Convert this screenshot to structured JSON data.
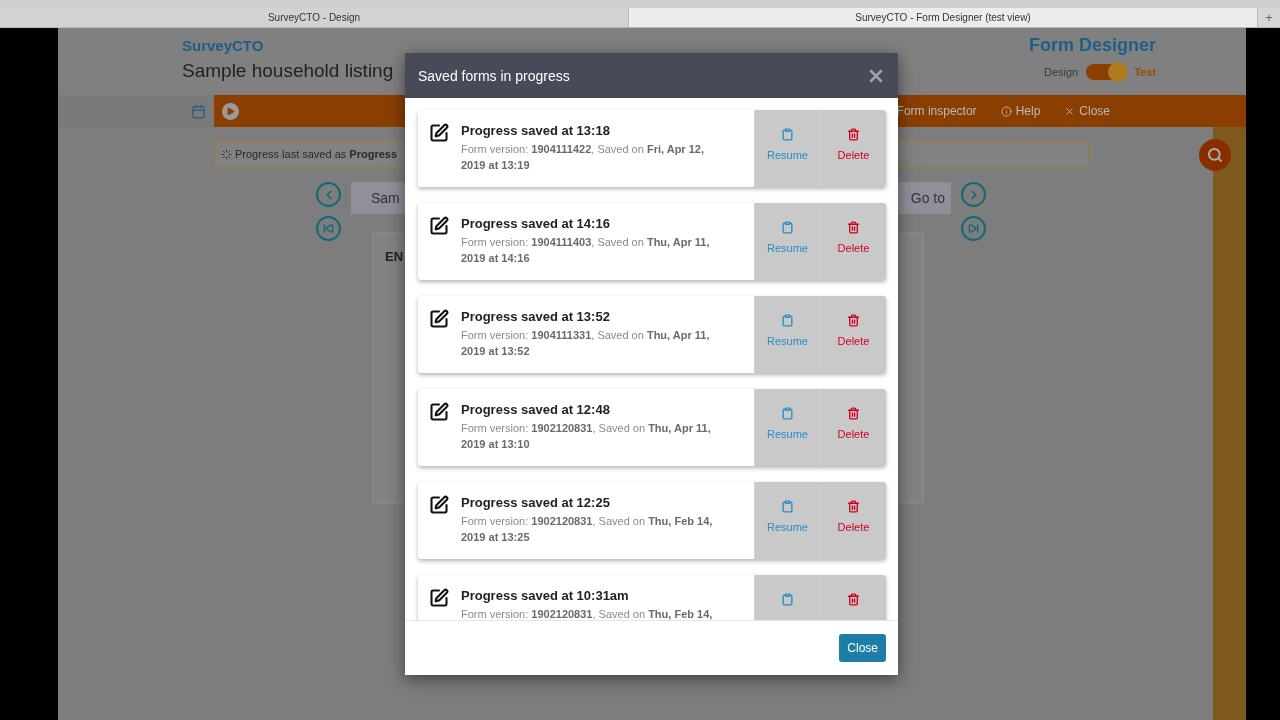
{
  "browser_tabs": [
    {
      "label": "SurveyCTO - Design",
      "selected": false
    },
    {
      "label": "SurveyCTO - Form Designer (test view)",
      "selected": true
    }
  ],
  "new_tab": "+",
  "header": {
    "logo": "SurveyCTO",
    "form_title": "Sample household listing",
    "app_title": "Form Designer",
    "mode_left": "Design",
    "mode_right": "Test",
    "test_mode": true
  },
  "toolbar": {
    "items": [
      {
        "kind": "inspector",
        "label": "Form inspector"
      },
      {
        "kind": "help",
        "label": "Help"
      },
      {
        "kind": "close",
        "label": "Close"
      }
    ]
  },
  "banner": "Progress last saved as **Progress**",
  "nav": {
    "group_left": "Sam",
    "group_right": "Go to",
    "field_label": "EN"
  },
  "modal": {
    "title": "Saved forms in progress",
    "entries": [
      {
        "title": "Progress saved at 13:18",
        "detail": "Form version: **1904111422**, Saved on **Fri, Apr 12, 2019 at 13:19**",
        "resume": "Resume",
        "delete": "Delete"
      },
      {
        "title": "Progress saved at 14:16",
        "detail": "Form version: **1904111403**, Saved on **Thu, Apr 11, 2019 at 14:16**",
        "resume": "Resume",
        "delete": "Delete"
      },
      {
        "title": "Progress saved at 13:52",
        "detail": "Form version: **1904111331**, Saved on **Thu, Apr 11, 2019 at 13:52**",
        "resume": "Resume",
        "delete": "Delete"
      },
      {
        "title": "Progress saved at 12:48",
        "detail": "Form version: **1902120831**, Saved on **Thu, Apr 11, 2019 at 13:10**",
        "resume": "Resume",
        "delete": "Delete"
      },
      {
        "title": "Progress saved at 12:25",
        "detail": "Form version: **1902120831**, Saved on **Thu, Feb 14, 2019 at 13:25**",
        "resume": "Resume",
        "delete": "Delete"
      },
      {
        "title": "Progress saved at 10:31am",
        "detail": "Form version: **1902120831**, Saved on **Thu, Feb 14,**"
      }
    ],
    "close_button": "Close"
  }
}
